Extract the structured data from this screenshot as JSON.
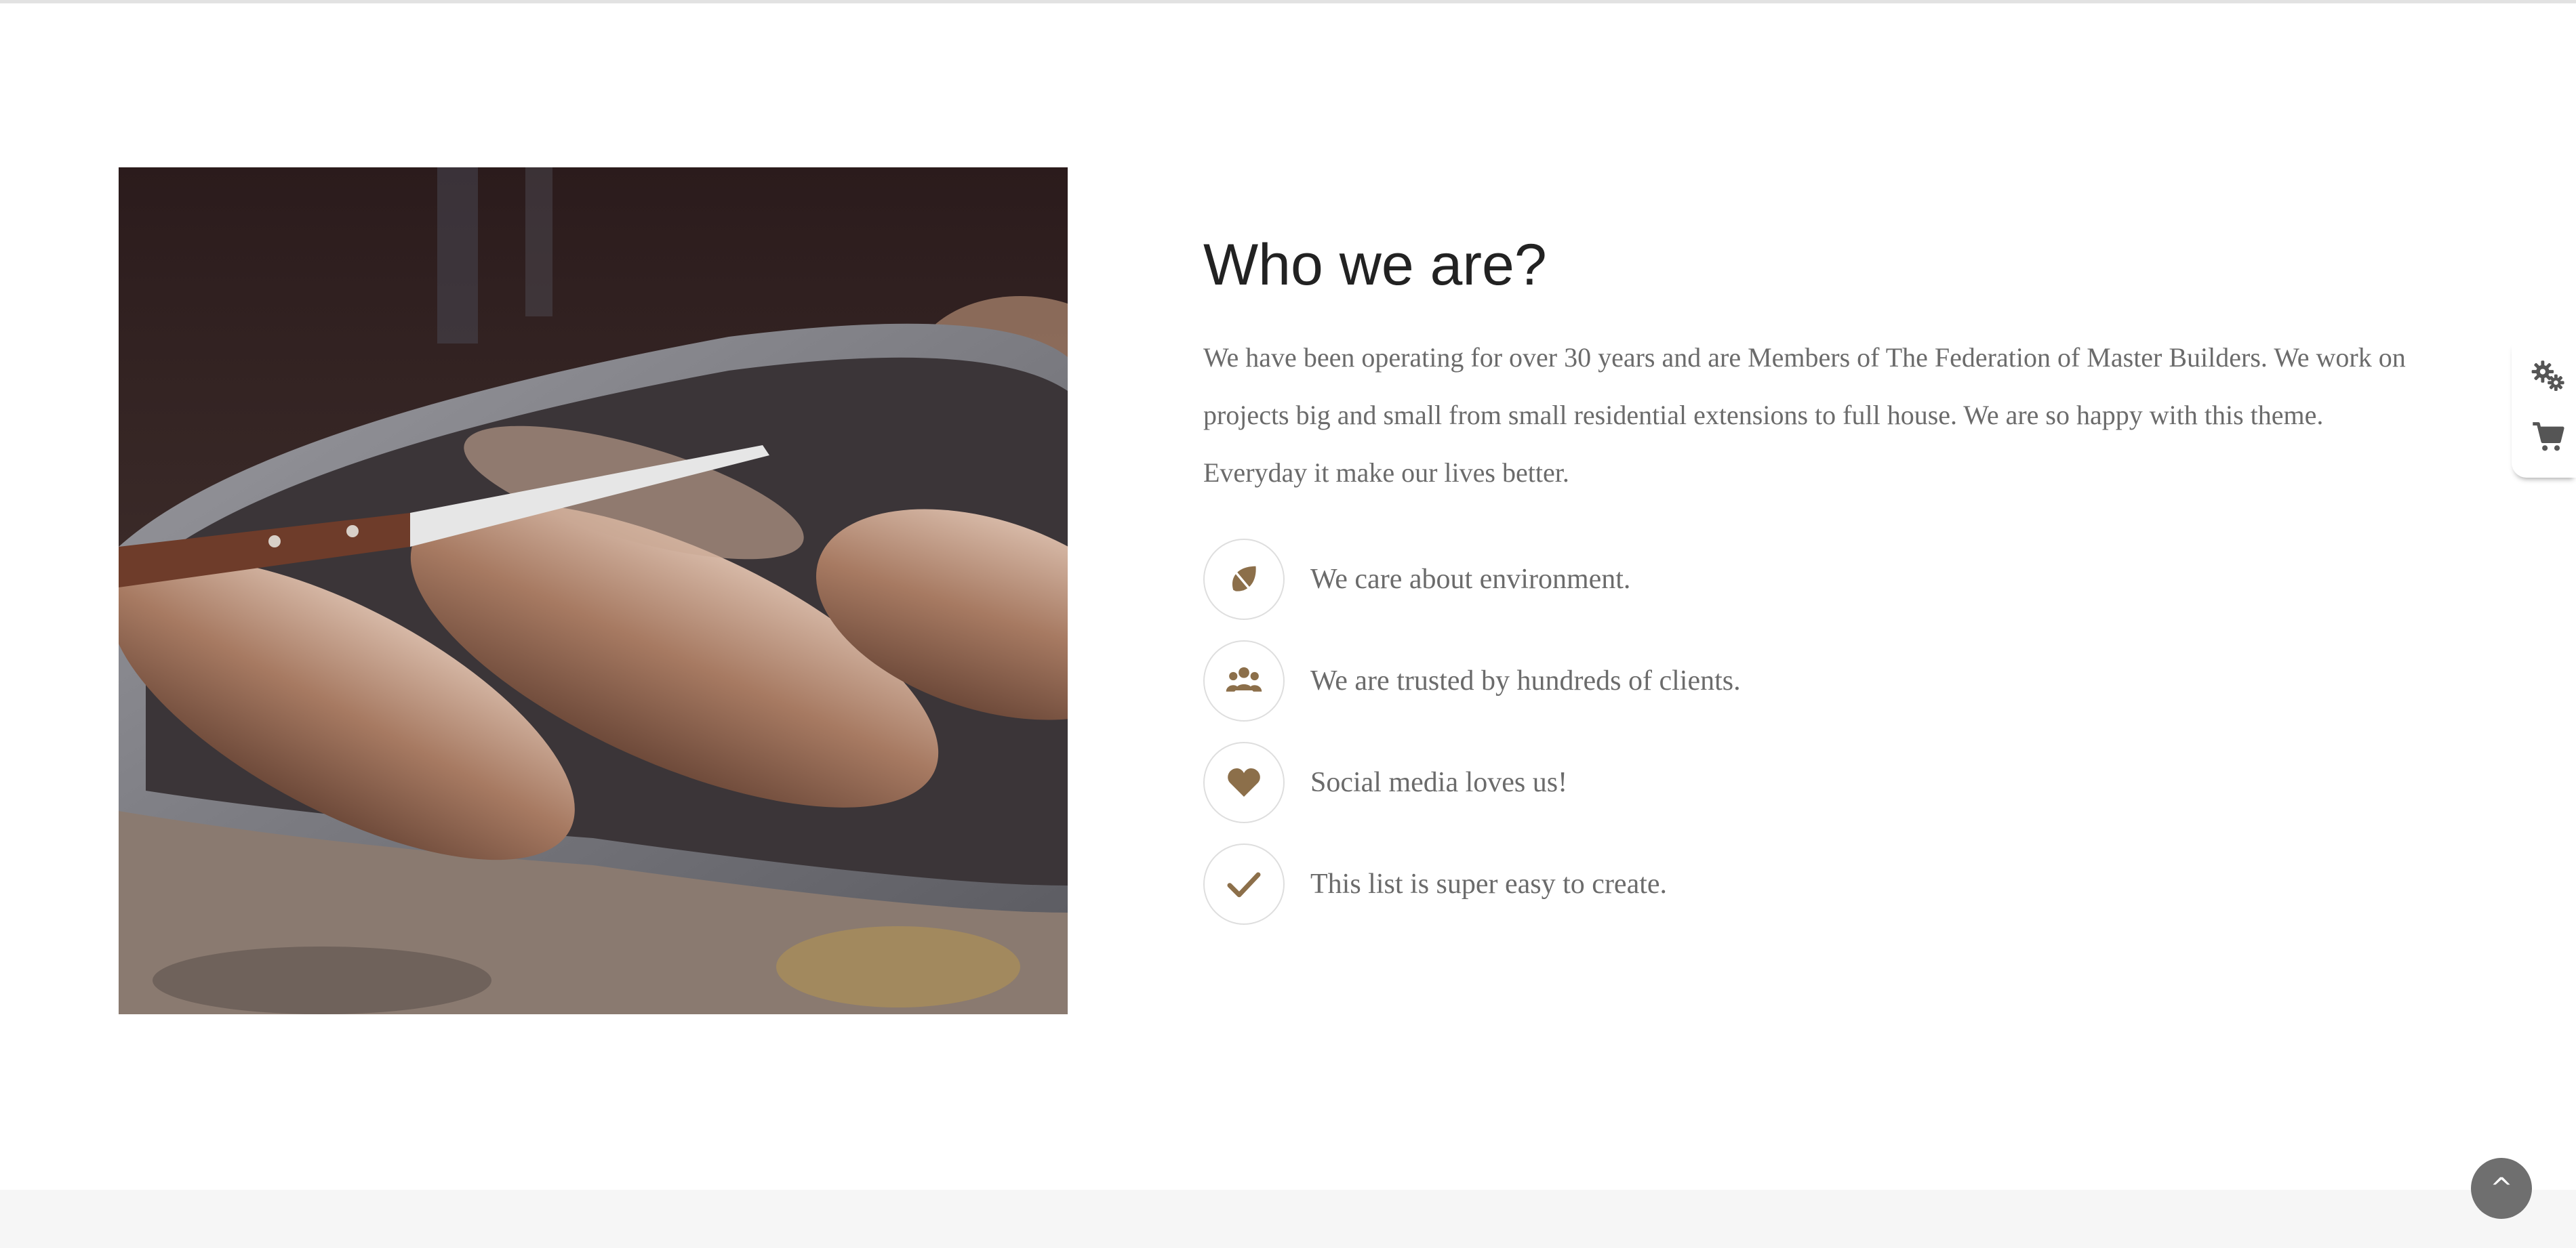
{
  "about": {
    "title": "Who we are?",
    "intro": "We have been operating for over 30 years and are Members of The Federation of Master Builders. We work on projects big and small from small residential extensions to full house. We are so happy with this theme. Everyday it make our lives better.",
    "features": [
      {
        "icon": "leaf-icon",
        "label": "We care about environment."
      },
      {
        "icon": "users-icon",
        "label": "We are trusted by hundreds of clients."
      },
      {
        "icon": "heart-icon",
        "label": "Social media loves us!"
      },
      {
        "icon": "check-icon",
        "label": "This list is super easy to create."
      }
    ]
  },
  "image": {
    "subject": "bread-tray-photo"
  },
  "side_tools": [
    {
      "icon": "gears-icon"
    },
    {
      "icon": "cart-icon"
    }
  ],
  "back_to_top": {
    "label": "^"
  },
  "colors": {
    "accent": "#8c6f4a",
    "text": "#6b6b6b",
    "heading": "#222222",
    "footer": "#f6f6f6",
    "back_to_top_bg": "#6f6f6f"
  }
}
